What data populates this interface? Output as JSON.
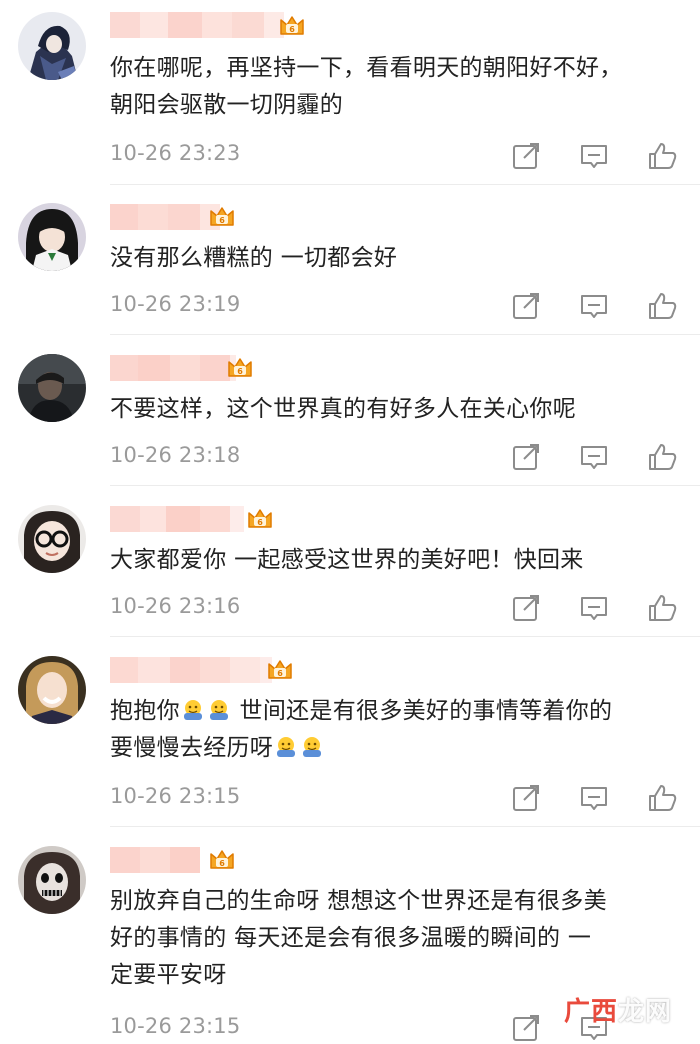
{
  "comments": [
    {
      "avatar": "avatar-anime-blue",
      "text_lines": [
        "你在哪呢，再坚持一下，看看明天的朝阳好不好，",
        "朝阳会驱散一切阴霾的"
      ],
      "time": "10-26 23:23"
    },
    {
      "avatar": "avatar-anime-girl",
      "text_lines": [
        "没有那么糟糕的 一切都会好"
      ],
      "time": "10-26 23:19"
    },
    {
      "avatar": "avatar-dark-portrait",
      "text_lines": [
        "不要这样，这个世界真的有好多人在关心你呢"
      ],
      "time": "10-26 23:18"
    },
    {
      "avatar": "avatar-glasses-girl",
      "text_lines": [
        "大家都爱你 一起感受这世界的美好吧！快回来"
      ],
      "time": "10-26 23:16"
    },
    {
      "avatar": "avatar-smiling-girl",
      "text_lines": [
        "抱抱你",
        " 世间还是有很多美好的事情等着你的",
        "要慢慢去经历呀"
      ],
      "time": "10-26 23:15"
    },
    {
      "avatar": "avatar-skull-face",
      "text_lines": [
        "别放弃自己的生命呀 想想这个世界还是有很多美",
        "好的事情的 每天还是会有很多温暖的瞬间的 一",
        "定要平安呀"
      ],
      "time": "10-26 23:15"
    }
  ],
  "icons": {
    "share": "share-icon",
    "reply": "comment-icon",
    "like": "thumbs-up-icon",
    "badge": "vip-crown-badge-icon",
    "emoji": "hug-emoji-icon"
  },
  "watermark": {
    "prefix": "广西",
    "suffix": "龙网"
  },
  "colors": {
    "text": "#222222",
    "time": "#9a9a9a",
    "badge": "#f5a623",
    "badge_dark": "#e07b00",
    "icon": "#8c8c8c",
    "divider": "#ececec"
  }
}
